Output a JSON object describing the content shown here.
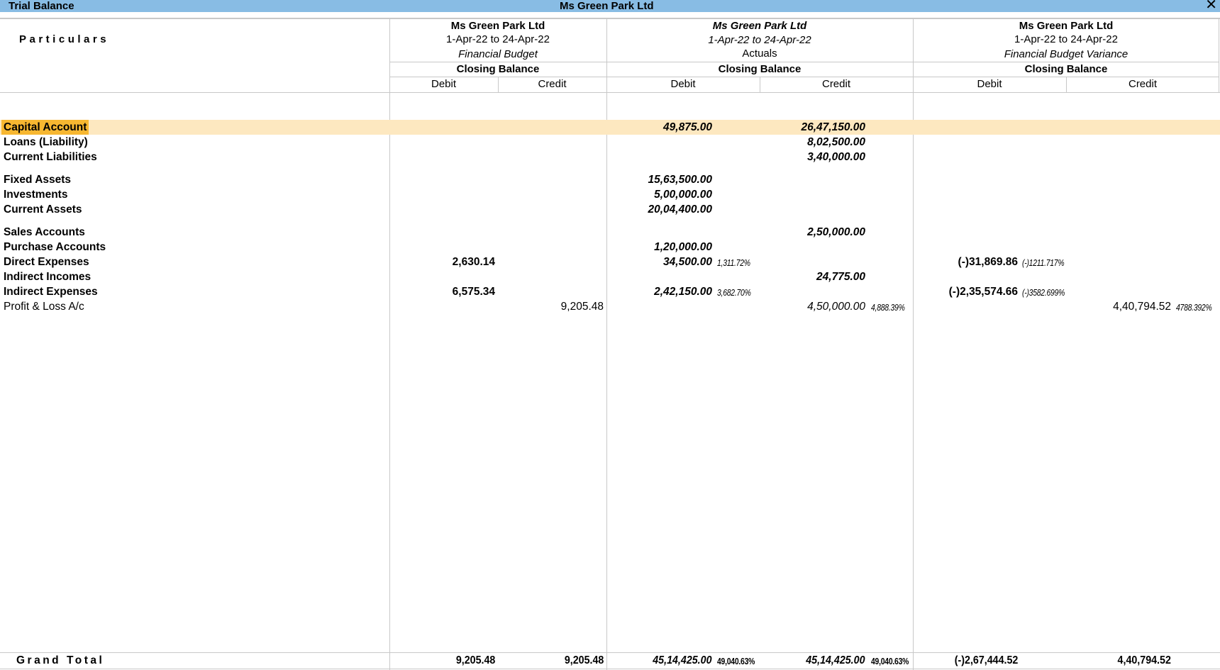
{
  "window": {
    "title": "Trial Balance",
    "company": "Ms Green Park Ltd",
    "close_icon": "close-icon"
  },
  "header": {
    "particulars": "Particulars",
    "columns": [
      {
        "company": "Ms Green Park Ltd",
        "period": "1-Apr-22 to 24-Apr-22",
        "scenario": "Financial Budget",
        "balance_label": "Closing Balance",
        "debit": "Debit",
        "credit": "Credit"
      },
      {
        "company": "Ms Green Park Ltd",
        "period": "1-Apr-22 to 24-Apr-22",
        "scenario": "Actuals",
        "balance_label": "Closing Balance",
        "debit": "Debit",
        "credit": "Credit"
      },
      {
        "company": "Ms Green Park Ltd",
        "period": "1-Apr-22 to 24-Apr-22",
        "scenario": "Financial Budget Variance",
        "balance_label": "Closing Balance",
        "debit": "Debit",
        "credit": "Credit"
      }
    ]
  },
  "rows": [
    {
      "name": "Capital Account",
      "highlighted": true,
      "budget_dr": "",
      "budget_cr": "",
      "actual_dr": "49,875.00",
      "actual_dr_pct": "",
      "actual_cr": "26,47,150.00",
      "actual_cr_pct": "",
      "var_dr": "",
      "var_dr_pct": "",
      "var_cr": "",
      "var_cr_pct": ""
    },
    {
      "name": "Loans (Liability)",
      "budget_dr": "",
      "budget_cr": "",
      "actual_dr": "",
      "actual_dr_pct": "",
      "actual_cr": "8,02,500.00",
      "actual_cr_pct": "",
      "var_dr": "",
      "var_dr_pct": "",
      "var_cr": "",
      "var_cr_pct": ""
    },
    {
      "name": "Current Liabilities",
      "budget_dr": "",
      "budget_cr": "",
      "actual_dr": "",
      "actual_dr_pct": "",
      "actual_cr": "3,40,000.00",
      "actual_cr_pct": "",
      "var_dr": "",
      "var_dr_pct": "",
      "var_cr": "",
      "var_cr_pct": ""
    },
    {
      "name": "Fixed Assets",
      "budget_dr": "",
      "budget_cr": "",
      "actual_dr": "15,63,500.00",
      "actual_dr_pct": "",
      "actual_cr": "",
      "actual_cr_pct": "",
      "var_dr": "",
      "var_dr_pct": "",
      "var_cr": "",
      "var_cr_pct": ""
    },
    {
      "name": "Investments",
      "budget_dr": "",
      "budget_cr": "",
      "actual_dr": "5,00,000.00",
      "actual_dr_pct": "",
      "actual_cr": "",
      "actual_cr_pct": "",
      "var_dr": "",
      "var_dr_pct": "",
      "var_cr": "",
      "var_cr_pct": ""
    },
    {
      "name": "Current Assets",
      "budget_dr": "",
      "budget_cr": "",
      "actual_dr": "20,04,400.00",
      "actual_dr_pct": "",
      "actual_cr": "",
      "actual_cr_pct": "",
      "var_dr": "",
      "var_dr_pct": "",
      "var_cr": "",
      "var_cr_pct": ""
    },
    {
      "name": "Sales Accounts",
      "budget_dr": "",
      "budget_cr": "",
      "actual_dr": "",
      "actual_dr_pct": "",
      "actual_cr": "2,50,000.00",
      "actual_cr_pct": "",
      "var_dr": "",
      "var_dr_pct": "",
      "var_cr": "",
      "var_cr_pct": ""
    },
    {
      "name": "Purchase Accounts",
      "budget_dr": "",
      "budget_cr": "",
      "actual_dr": "1,20,000.00",
      "actual_dr_pct": "",
      "actual_cr": "",
      "actual_cr_pct": "",
      "var_dr": "",
      "var_dr_pct": "",
      "var_cr": "",
      "var_cr_pct": ""
    },
    {
      "name": "Direct Expenses",
      "budget_dr": "2,630.14",
      "budget_cr": "",
      "actual_dr": "34,500.00",
      "actual_dr_pct": "1,311.72%",
      "actual_cr": "",
      "actual_cr_pct": "",
      "var_dr": "(-)31,869.86",
      "var_dr_pct": "(-)1211.717%",
      "var_cr": "",
      "var_cr_pct": ""
    },
    {
      "name": "Indirect Incomes",
      "budget_dr": "",
      "budget_cr": "",
      "actual_dr": "",
      "actual_dr_pct": "",
      "actual_cr": "24,775.00",
      "actual_cr_pct": "",
      "var_dr": "",
      "var_dr_pct": "",
      "var_cr": "",
      "var_cr_pct": ""
    },
    {
      "name": "Indirect Expenses",
      "budget_dr": "6,575.34",
      "budget_cr": "",
      "actual_dr": "2,42,150.00",
      "actual_dr_pct": "3,682.70%",
      "actual_cr": "",
      "actual_cr_pct": "",
      "var_dr": "(-)2,35,574.66",
      "var_dr_pct": "(-)3582.699%",
      "var_cr": "",
      "var_cr_pct": ""
    },
    {
      "name": "Profit & Loss A/c",
      "plain": true,
      "budget_dr": "",
      "budget_cr": "9,205.48",
      "actual_dr": "",
      "actual_dr_pct": "",
      "actual_cr": "4,50,000.00",
      "actual_cr_pct": "4,888.39%",
      "var_dr": "",
      "var_dr_pct": "",
      "var_cr": "4,40,794.52",
      "var_cr_pct": "4788.392%"
    }
  ],
  "grand_total": {
    "label": "Grand Total",
    "budget_dr": "9,205.48",
    "budget_cr": "9,205.48",
    "actual_dr": "45,14,425.00",
    "actual_dr_pct": "49,040.63%",
    "actual_cr": "45,14,425.00",
    "actual_cr_pct": "49,040.63%",
    "var_dr": "(-)2,67,444.52",
    "var_cr": "4,40,794.52"
  },
  "colors": {
    "titlebar": "#88bce4",
    "highlight_row": "#fde8c0",
    "highlight_label": "#f7b731"
  }
}
